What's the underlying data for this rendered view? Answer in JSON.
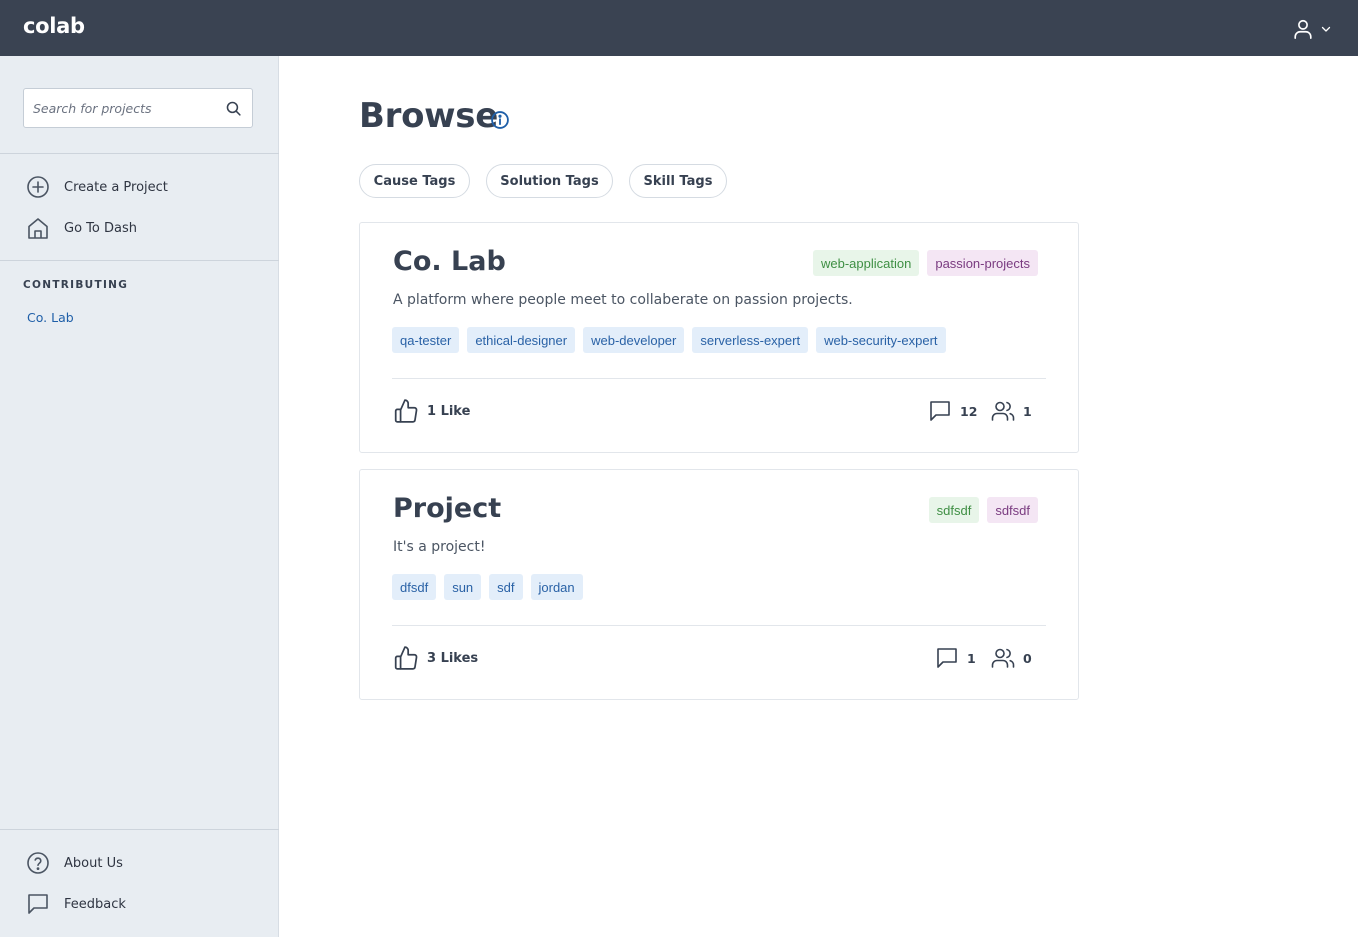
{
  "app": {
    "logo": "colab"
  },
  "sidebar": {
    "search_placeholder": "Search for projects",
    "nav": [
      {
        "label": "Create a Project",
        "icon": "plus-circle-icon"
      },
      {
        "label": "Go To Dash",
        "icon": "home-icon"
      }
    ],
    "section_label": "CONTRIBUTING",
    "contributing": [
      {
        "label": "Co. Lab"
      }
    ],
    "footer": [
      {
        "label": "About Us",
        "icon": "help-circle-icon"
      },
      {
        "label": "Feedback",
        "icon": "message-square-icon"
      }
    ]
  },
  "main": {
    "title": "Browse",
    "filters": [
      {
        "label": "Cause Tags"
      },
      {
        "label": "Solution Tags"
      },
      {
        "label": "Skill Tags"
      }
    ],
    "projects": [
      {
        "title": "Co. Lab",
        "description": "A platform where people meet to collaberate on passion projects.",
        "cause_tags": [
          "web-application",
          "passion-projects"
        ],
        "skill_tags": [
          "qa-tester",
          "ethical-designer",
          "web-developer",
          "serverless-expert",
          "web-security-expert"
        ],
        "likes": "1 Like",
        "comments": "12",
        "members": "1"
      },
      {
        "title": "Project",
        "description": "It's a project!",
        "cause_tags": [
          "sdfsdf",
          "sdfsdf"
        ],
        "skill_tags": [
          "dfsdf",
          "sun",
          "sdf",
          "jordan"
        ],
        "likes": "3 Likes",
        "comments": "1",
        "members": "0"
      }
    ]
  },
  "colors": {
    "topbar": "#3a4352",
    "sidebar": "#e8edf2",
    "link": "#1f5fa8",
    "tag_green_bg": "#e8f5e9",
    "tag_purple_bg": "#f4e6f4",
    "tag_blue_bg": "#e3eefa"
  }
}
